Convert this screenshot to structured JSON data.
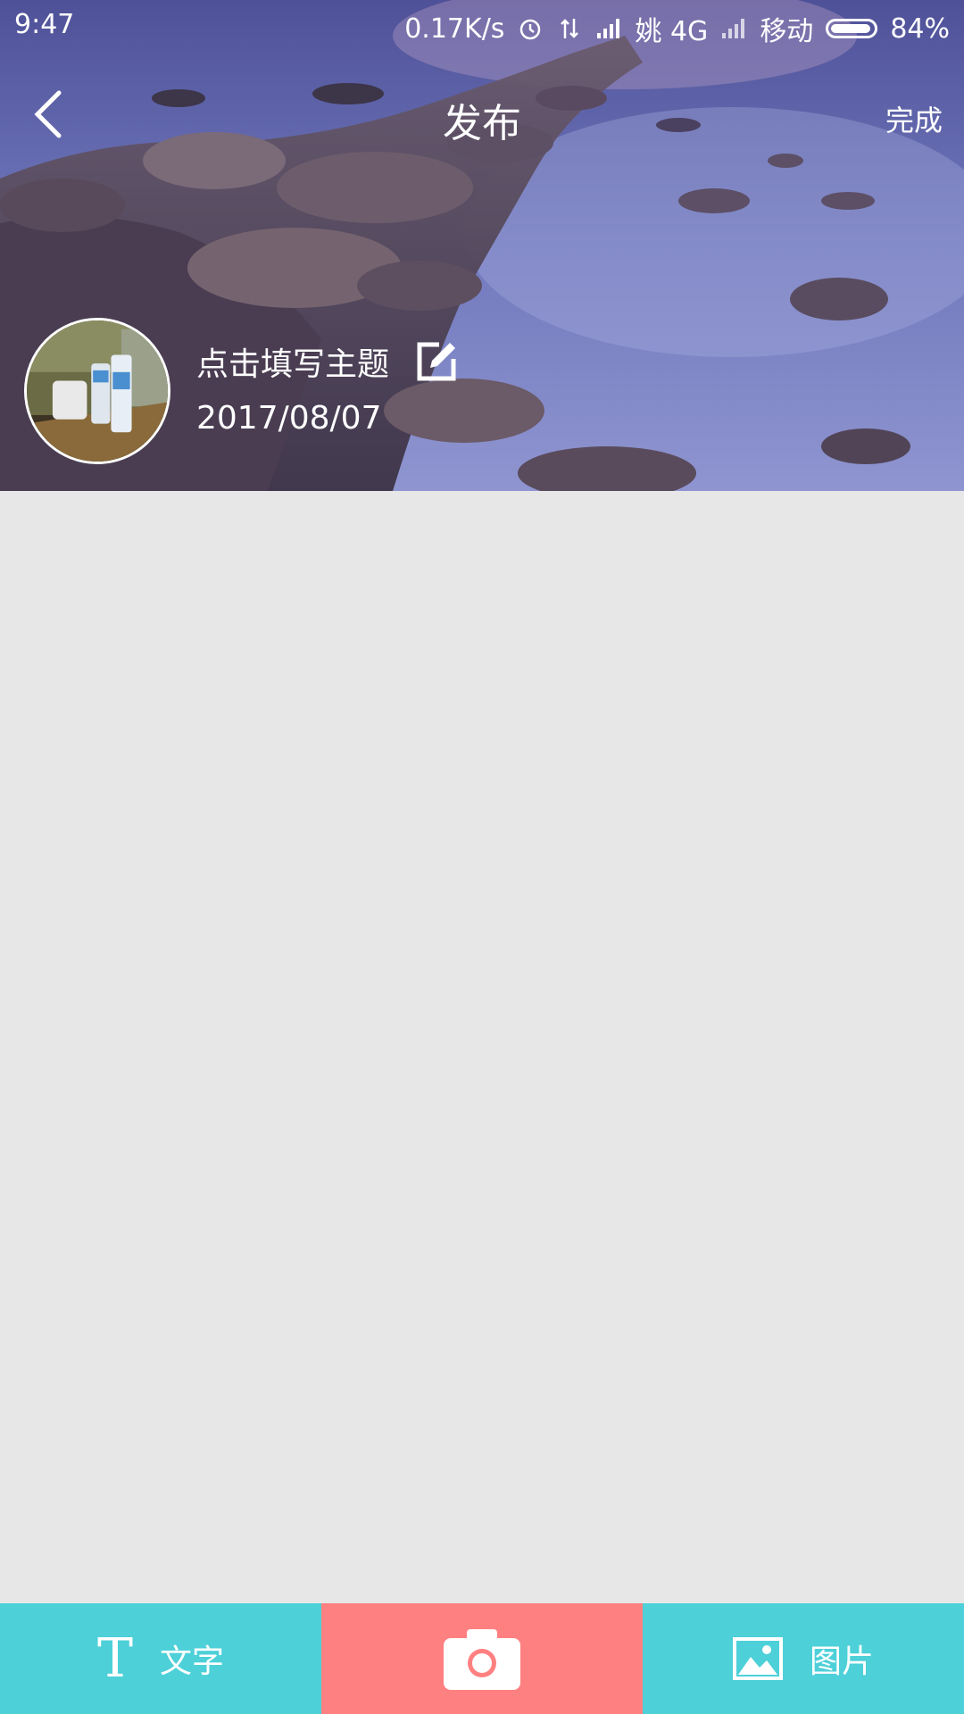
{
  "status_bar": {
    "time": "9:47",
    "net_speed": "0.17K/s",
    "carrier_1": "姚 4G",
    "carrier_2": "移动",
    "battery": "84%"
  },
  "header": {
    "title": "发布",
    "done_label": "完成"
  },
  "post": {
    "subject_placeholder": "点击填写主题",
    "date": "2017/08/07"
  },
  "toolbar": {
    "text_label": "文字",
    "text_glyph": "T",
    "image_label": "图片"
  },
  "colors": {
    "toolbar_teal": "#4dd0d8",
    "toolbar_pink": "#ff8080",
    "content_bg": "#e7e7e8"
  }
}
